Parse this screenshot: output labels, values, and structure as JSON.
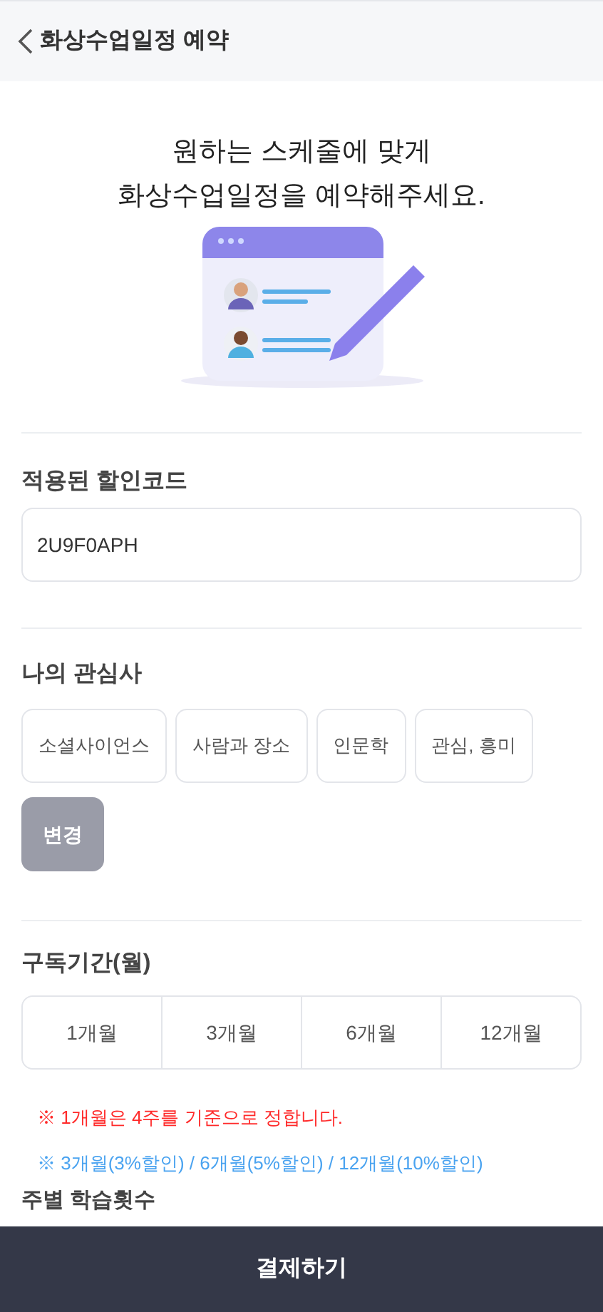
{
  "header": {
    "title": "화상수업일정 예약"
  },
  "intro": [
    "원하는 스케줄에 맞게",
    "화상수업일정을 예약해주세요."
  ],
  "discount": {
    "label": "적용된 할인코드",
    "value": "2U9F0APH"
  },
  "interests": {
    "label": "나의 관심사",
    "items": [
      "소셜사이언스",
      "사람과 장소",
      "인문학",
      "관심, 흥미"
    ],
    "change_button": "변경"
  },
  "period": {
    "label": "구독기간(월)",
    "options": [
      "1개월",
      "3개월",
      "6개월",
      "12개월"
    ],
    "notes": [
      {
        "text": "※ 1개월은 4주를 기준으로 정합니다.",
        "color": "#ff2a2a"
      },
      {
        "text": "※ 3개월(3%할인) / 6개월(5%할인) / 12개월(10%할인)",
        "color": "#4aa3f0"
      }
    ]
  },
  "next_section": {
    "label": "주별 학습횟수"
  },
  "pay_button": "결제하기"
}
